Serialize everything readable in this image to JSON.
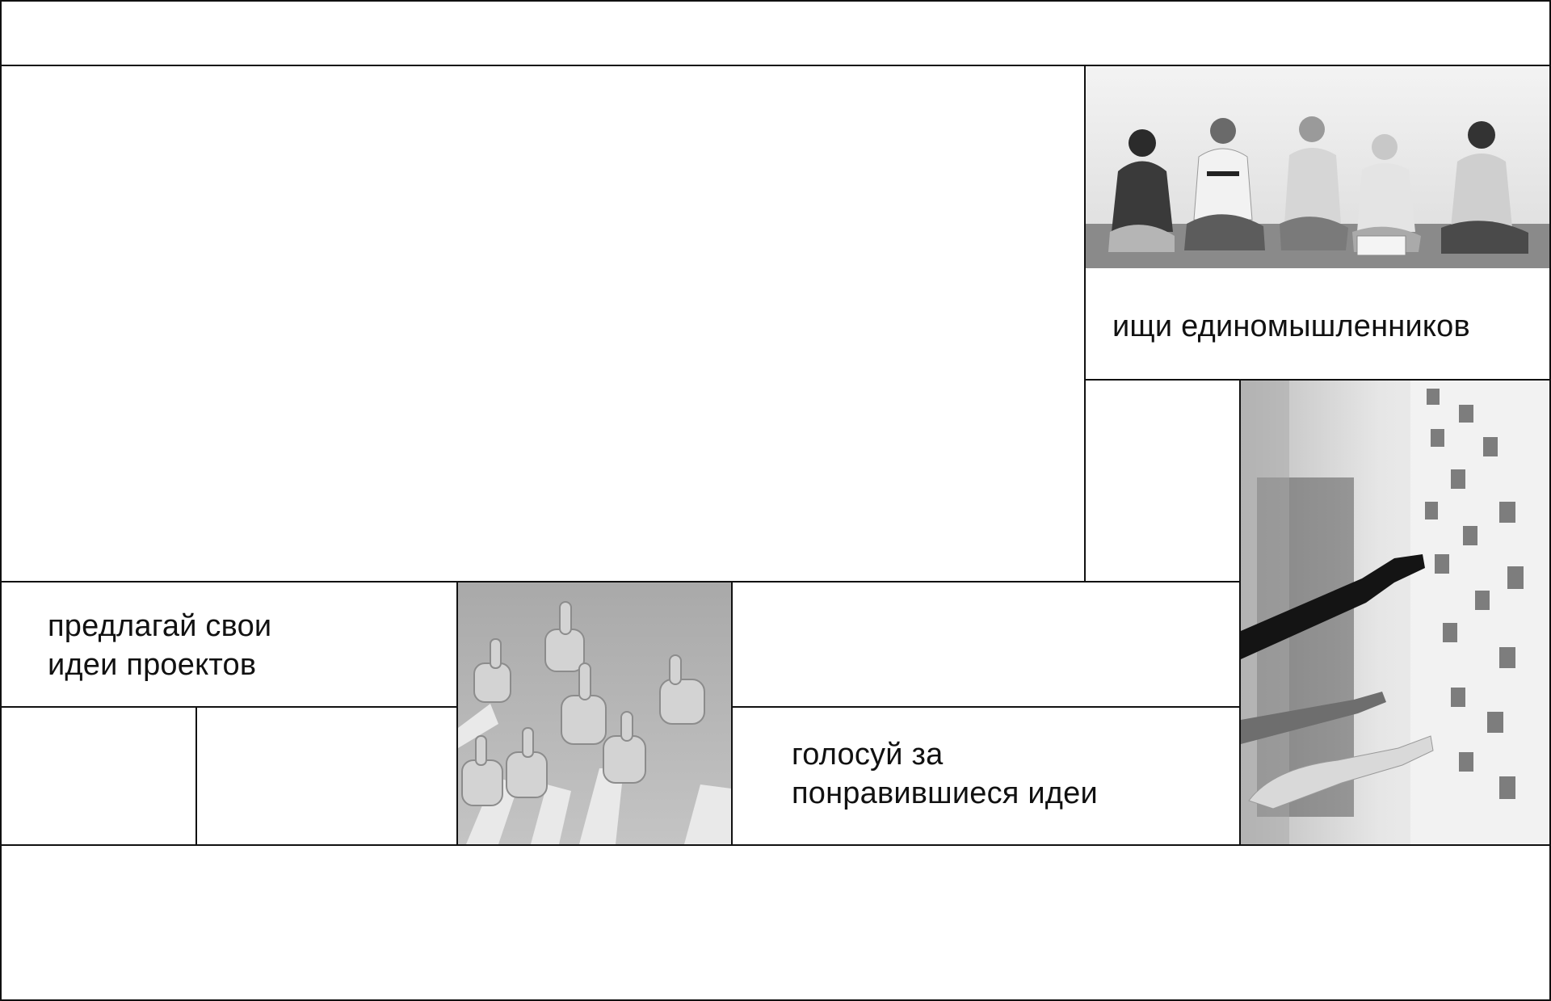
{
  "features": {
    "find_people": "ищи единомышленников",
    "propose_line1": "предлагай свои",
    "propose_line2": "идеи проектов",
    "vote_line1": "голосуй за",
    "vote_line2": "понравившиеся идеи"
  },
  "images": {
    "group_photo": "group-of-students-sitting-photo",
    "thumbs_photo": "thumbs-up-hands-photo",
    "sticky_notes_photo": "sticky-notes-wall-photo"
  },
  "colors": {
    "line": "#111111",
    "background": "#ffffff"
  }
}
